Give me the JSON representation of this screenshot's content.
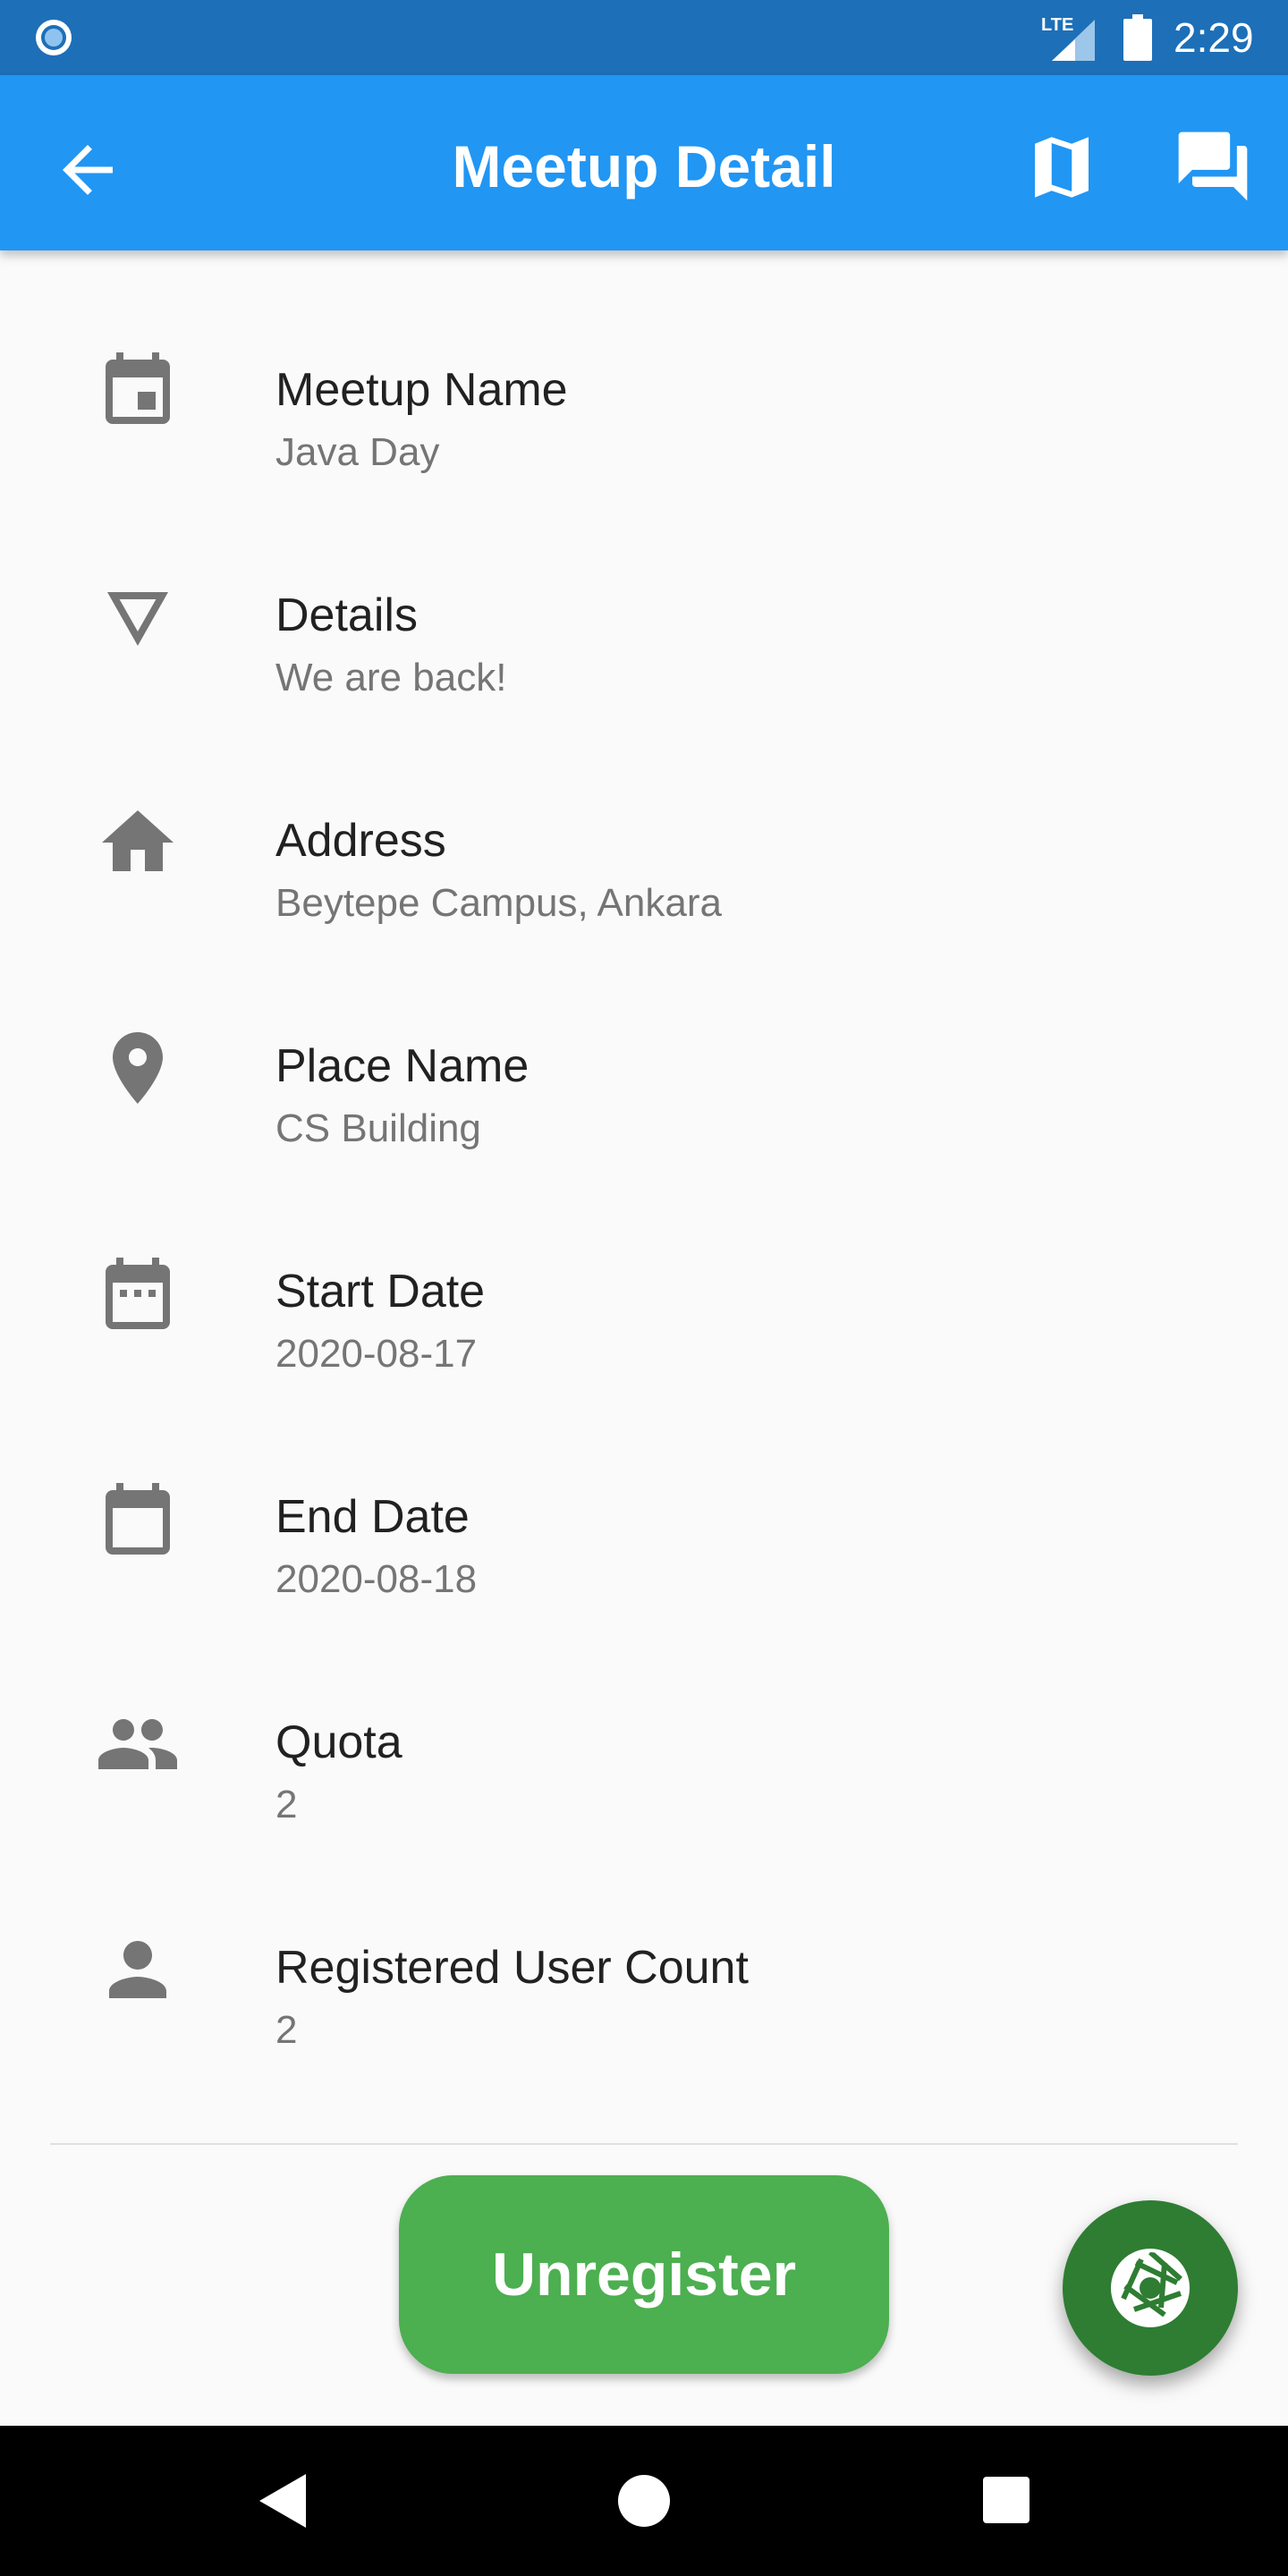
{
  "status_bar": {
    "time": "2:29",
    "left_icon": "circle-notification-icon",
    "network_label": "LTE",
    "icons": [
      "lte-signal-icon",
      "battery-icon"
    ]
  },
  "app_bar": {
    "title": "Meetup Detail",
    "back_icon": "arrow-back-icon",
    "actions": [
      "map-icon",
      "forum-icon"
    ]
  },
  "details": [
    {
      "icon": "event-icon",
      "title": "Meetup Name",
      "value": "Java Day"
    },
    {
      "icon": "triangle-down-icon",
      "title": "Details",
      "value": "We are back!"
    },
    {
      "icon": "home-icon",
      "title": "Address",
      "value": "Beytepe Campus, Ankara"
    },
    {
      "icon": "location-pin-icon",
      "title": "Place Name",
      "value": "CS Building"
    },
    {
      "icon": "date-range-icon",
      "title": "Start Date",
      "value": "2020-08-17"
    },
    {
      "icon": "calendar-blank-icon",
      "title": "End Date",
      "value": "2020-08-18"
    },
    {
      "icon": "people-icon",
      "title": "Quota",
      "value": "2"
    },
    {
      "icon": "person-icon",
      "title": "Registered User Count",
      "value": "2"
    }
  ],
  "actions": {
    "unregister_label": "Unregister",
    "fab_icon": "camera-shutter-icon"
  },
  "navigation": [
    "nav-back-icon",
    "nav-home-icon",
    "nav-recents-icon"
  ],
  "colors": {
    "status_bar": "#1d6fb8",
    "app_bar": "#2196f3",
    "background": "#fafafa",
    "button": "#4caf50",
    "fab": "#2e7d32",
    "icon": "#757575"
  }
}
